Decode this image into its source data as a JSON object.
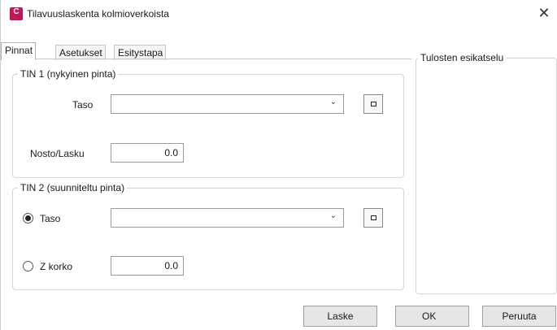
{
  "window": {
    "title": "Tilavuuslaskenta kolmioverkoista",
    "app_icon_letter": "C",
    "close_glyph": "✕"
  },
  "tabs": [
    {
      "label": "Pinnat",
      "active": true
    },
    {
      "label": "Asetukset",
      "active": false
    },
    {
      "label": "Esitystapa",
      "active": false
    }
  ],
  "tin1": {
    "group_label": "TIN 1 (nykyinen pinta)",
    "surface_label": "Taso",
    "surface_value": "",
    "offset_label": "Nosto/Lasku",
    "offset_value": "0.0"
  },
  "tin2": {
    "group_label": "TIN 2 (suunniteltu pinta)",
    "surface_label": "Taso",
    "surface_selected": true,
    "surface_value": "",
    "zlevel_label": "Z korko",
    "zlevel_selected": false,
    "zlevel_value": "0.0"
  },
  "preview": {
    "group_label": "Tulosten esikatselu"
  },
  "buttons": {
    "calculate": "Laske",
    "ok": "OK",
    "cancel": "Peruuta"
  },
  "icons": {
    "dropdown": "chevron-down-icon",
    "pick": "pick-square-icon"
  }
}
